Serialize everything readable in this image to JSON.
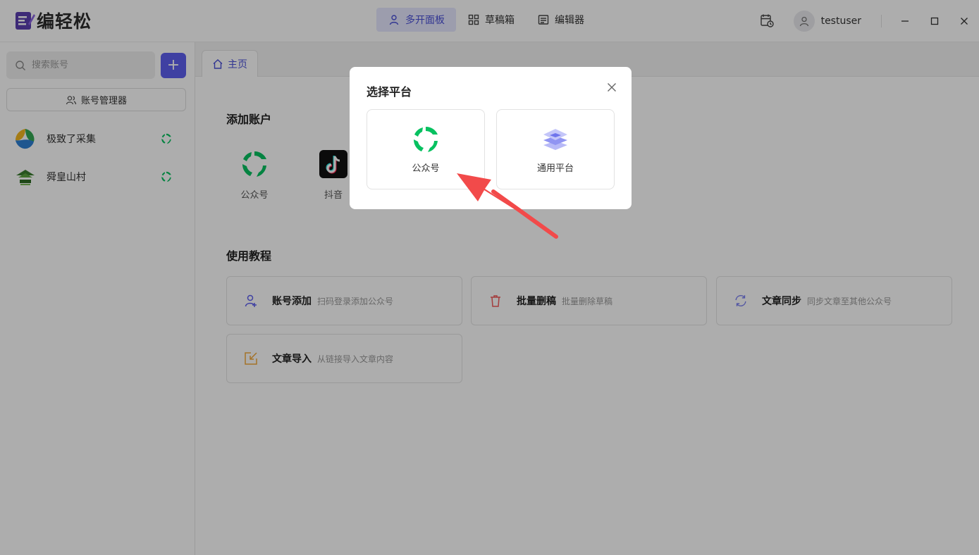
{
  "app": {
    "name": "编轻松"
  },
  "nav": {
    "items": [
      {
        "label": "多开面板",
        "icon": "user-icon",
        "active": true
      },
      {
        "label": "草稿箱",
        "icon": "grid-icon",
        "active": false
      },
      {
        "label": "编辑器",
        "icon": "editor-icon",
        "active": false
      }
    ]
  },
  "user": {
    "name": "testuser"
  },
  "sidebar": {
    "search_placeholder": "搜索账号",
    "add_label": "+",
    "manager_label": "账号管理器",
    "accounts": [
      {
        "name": "极致了采集",
        "platform": "wechat-icon"
      },
      {
        "name": "舜皇山村",
        "platform": "wechat-icon"
      }
    ]
  },
  "main": {
    "tab_label": "主页",
    "add_account_title": "添加账户",
    "platforms": [
      {
        "label": "公众号",
        "icon": "wechat-icon"
      },
      {
        "label": "抖音",
        "icon": "tiktok-icon"
      }
    ],
    "tutorial_title": "使用教程",
    "tutorials": [
      {
        "title": "账号添加",
        "desc": "扫码登录添加公众号",
        "icon": "add-user-icon"
      },
      {
        "title": "批量删稿",
        "desc": "批量删除草稿",
        "icon": "trash-icon"
      },
      {
        "title": "文章同步",
        "desc": "同步文章至其他公众号",
        "icon": "sync-icon"
      },
      {
        "title": "文章导入",
        "desc": "从链接导入文章内容",
        "icon": "import-icon"
      }
    ]
  },
  "modal": {
    "title": "选择平台",
    "options": [
      {
        "label": "公众号",
        "icon": "wechat-icon"
      },
      {
        "label": "通用平台",
        "icon": "layers-icon"
      }
    ]
  },
  "colors": {
    "accent": "#5d5fef",
    "wechat": "#07c160",
    "arrow": "#f24a4a"
  }
}
